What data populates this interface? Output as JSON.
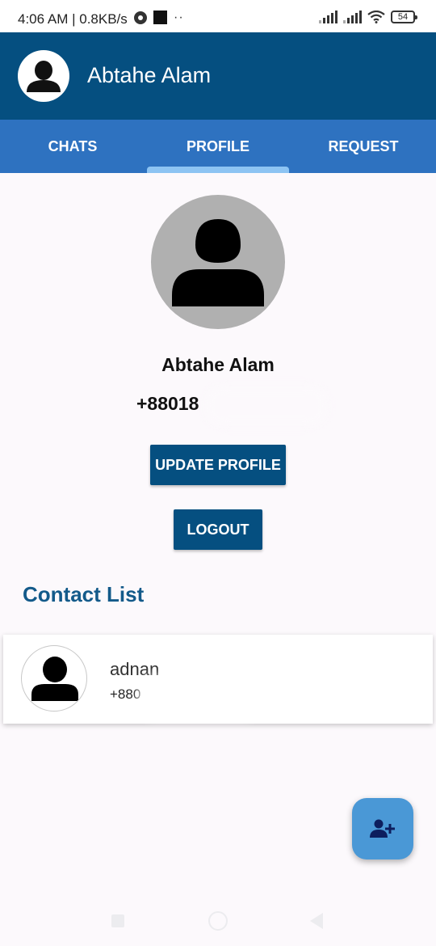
{
  "status_bar": {
    "time_speed": "4:06 AM | 0.8KB/s",
    "battery": "54"
  },
  "app_bar": {
    "title": "Abtahe Alam",
    "avatar_icon": "person-icon"
  },
  "tabs": [
    {
      "label": "CHATS",
      "selected": false
    },
    {
      "label": "PROFILE",
      "selected": true
    },
    {
      "label": "REQUEST",
      "selected": false
    }
  ],
  "profile": {
    "name": "Abtahe Alam",
    "phone": "+88018"
  },
  "buttons": {
    "update_profile": "UPDATE PROFILE",
    "logout": "LOGOUT"
  },
  "contact_list": {
    "heading": "Contact List",
    "items": [
      {
        "name": "adnan",
        "phone": "+880"
      }
    ]
  },
  "fab": {
    "icon": "person-add-icon"
  },
  "colors": {
    "app_bar": "#054f80",
    "tab_bar": "#2e72c0",
    "tab_indicator": "#8dc4f3",
    "button": "#054f80",
    "heading": "#135a8a",
    "fab": "#4a98d6"
  }
}
